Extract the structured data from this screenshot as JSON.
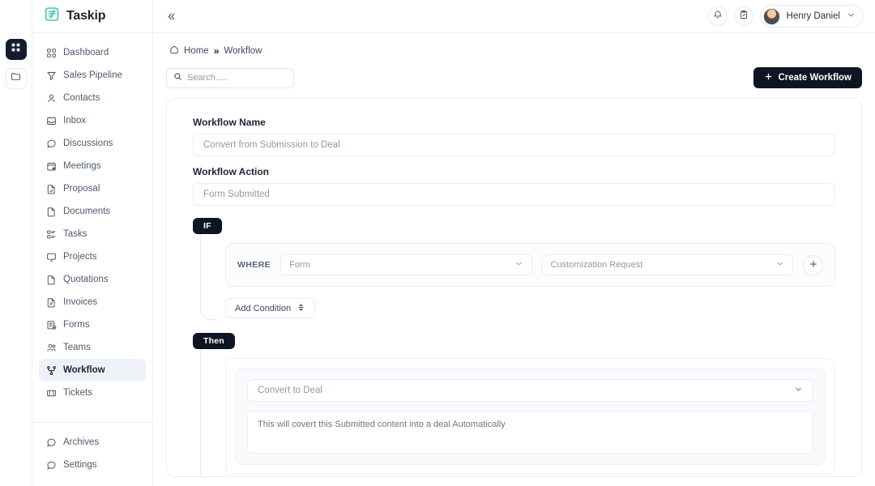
{
  "brand": {
    "name": "Taskip",
    "logo_icon": "taskip-logo-icon",
    "accent": "#2ec4a6"
  },
  "rail": {
    "items": [
      {
        "icon": "grid-apps-icon",
        "active": true
      },
      {
        "icon": "folder-icon",
        "active": false
      }
    ]
  },
  "sidebar": {
    "items": [
      {
        "label": "Dashboard",
        "icon": "dashboard-grid-icon"
      },
      {
        "label": "Sales Pipeline",
        "icon": "funnel-icon"
      },
      {
        "label": "Contacts",
        "icon": "user-icon"
      },
      {
        "label": "Inbox",
        "icon": "inbox-icon"
      },
      {
        "label": "Discussions",
        "icon": "chat-bubble-icon"
      },
      {
        "label": "Meetings",
        "icon": "calendar-clock-icon"
      },
      {
        "label": "Proposal",
        "icon": "file-proposal-icon"
      },
      {
        "label": "Documents",
        "icon": "file-document-icon"
      },
      {
        "label": "Tasks",
        "icon": "task-list-icon"
      },
      {
        "label": "Projects",
        "icon": "projects-board-icon"
      },
      {
        "label": "Quotations",
        "icon": "file-quote-icon"
      },
      {
        "label": "Invoices",
        "icon": "file-invoice-icon"
      },
      {
        "label": "Forms",
        "icon": "forms-icon"
      },
      {
        "label": "Teams",
        "icon": "users-group-icon"
      },
      {
        "label": "Workflow",
        "icon": "workflow-node-icon",
        "active": true
      },
      {
        "label": "Tickets",
        "icon": "ticket-icon"
      }
    ],
    "bottom_items": [
      {
        "label": "Archives",
        "icon": "archive-bubble-icon"
      },
      {
        "label": "Settings",
        "icon": "settings-bubble-icon"
      }
    ]
  },
  "topbar": {
    "collapse_icon": "chevron-double-left-icon",
    "notification_icon": "bell-icon",
    "tasks_icon": "clipboard-check-icon",
    "user_name": "Henry Daniel",
    "user_chevron_icon": "chevron-down-icon",
    "avatar": "avatar"
  },
  "breadcrumb": {
    "home_icon": "home-icon",
    "home": "Home",
    "separator": "»",
    "current": "Workflow"
  },
  "toolbar": {
    "search_icon": "search-icon",
    "search_value": "",
    "search_placeholder": "Search.....",
    "create_label": "Create Workflow",
    "create_icon": "plus-icon"
  },
  "builder": {
    "name_label": "Workflow Name",
    "name_value": "Convert from Submission to Deal",
    "action_label": "Workflow Action",
    "action_value": "Form Submitted",
    "if_badge": "IF",
    "where_label": "WHERE",
    "condition_field": "Form",
    "condition_value": "Customization Request",
    "add_rule_icon": "plus-icon",
    "add_condition_label": "Add Condition",
    "add_condition_icon": "sort-updown-icon",
    "then_badge": "Then",
    "then_action": "Convert to Deal",
    "then_chevron_icon": "chevron-down-icon",
    "then_description": "This will covert this Submitted content into a deal Automatically"
  }
}
